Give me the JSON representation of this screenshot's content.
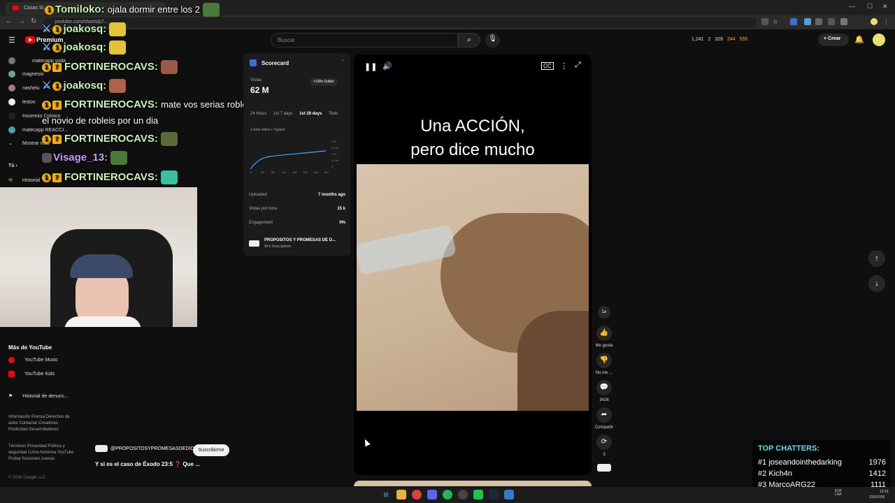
{
  "browser": {
    "tab_title": "Cosas Si...",
    "url": "youtube.com/shorts/p7...",
    "win_controls": [
      "—",
      "☐",
      "✕"
    ]
  },
  "header": {
    "brand": "Premium",
    "search_placeholder": "Buscar",
    "stats": [
      "1,241",
      "2",
      "328",
      "244",
      "555"
    ],
    "create_label": "+ Crear"
  },
  "sidebar": {
    "subscriptions": [
      {
        "label": "matecapp yoda"
      },
      {
        "label": "magnesio"
      },
      {
        "label": "nashelu"
      },
      {
        "label": "leston"
      },
      {
        "label": "Insomnio Crónico"
      },
      {
        "label": "matecapp REACCI..."
      }
    ],
    "show_more": "Mostrar más",
    "you": "Tú",
    "history": "Historial",
    "more_header": "Más de YouTube",
    "more_items": [
      {
        "label": "YouTube Music"
      },
      {
        "label": "YouTube Kids"
      }
    ],
    "report_history": "Historial de denunc...",
    "footer1": "Información  Prensa  Derechos de autor  Contactar  Creadores  Publicidad  Desarrolladores",
    "footer2": "Términos  Privacidad  Política y seguridad  Cómo funciona YouTube  Probar funciones nuevas",
    "copyright": "© 2026 Google LLC"
  },
  "chat": [
    {
      "user": "Tomiloko:",
      "msg": "ojala dormir entre los 2"
    },
    {
      "user": "joakosq:",
      "msg": ""
    },
    {
      "user": "joakosq:",
      "msg": ""
    },
    {
      "user": "FORTINEROCAVS:",
      "msg": ""
    },
    {
      "user": "joakosq:",
      "msg": ""
    },
    {
      "user": "FORTINEROCAVS:",
      "msg": "mate vos serias robleis o"
    },
    {
      "user": "",
      "msg": "el novio de robleis por un dia"
    },
    {
      "user": "FORTINEROCAVS:",
      "msg": ""
    },
    {
      "user": "Visage_13:",
      "msg": ""
    },
    {
      "user": "FORTINEROCAVS:",
      "msg": ""
    }
  ],
  "scorecard": {
    "title": "Scorecard",
    "views_label": "Vistas",
    "views_value": "62 M",
    "outlier": ">100x Outlier",
    "ranges": [
      "24 hours",
      "1st 7 days",
      "1st 28 days",
      "Todo"
    ],
    "active_range": "1st 28 days",
    "legend": [
      "Este video",
      "Typical"
    ],
    "y_ticks": [
      "6 M",
      "4.5 M",
      "3 M",
      "1.5 M",
      "0"
    ],
    "x_ticks": [
      "0",
      "40",
      "80",
      "120",
      "160",
      "200",
      "240",
      "280"
    ],
    "rows": [
      {
        "k": "Uploaded",
        "v": "7 months ago"
      },
      {
        "k": "Vistas por hora",
        "v": "15 k"
      },
      {
        "k": "Engagement",
        "v": "0%"
      }
    ],
    "channel_name": "PROPOSITOS Y PROMESAS DE D...",
    "channel_subs": "99 k Suscriptores"
  },
  "player": {
    "caption_line1": "Una ACCIÓN,",
    "caption_line2": "pero dice mucho"
  },
  "actions": {
    "speed": "1x",
    "like_label": "Me gusta",
    "dislike_label": "No me ...",
    "comments_count": "3426",
    "share_label": "Compartir",
    "remix_count": "3"
  },
  "channel": {
    "handle": "@PROPOSITOSYPROMESASDEDIOS",
    "subscribe_label": "Suscribirme",
    "video_title": "Y si es el caso de Éxodo 23:5 ❓ Que ..."
  },
  "top_chatters": {
    "title": "TOP CHATTERS:",
    "rows": [
      {
        "rank": "#1",
        "name": "joseandointhedarking",
        "count": "1976"
      },
      {
        "rank": "#2",
        "name": "Kich4n",
        "count": "1412"
      },
      {
        "rank": "#3",
        "name": "MarcoARG22",
        "count": "1111"
      }
    ]
  },
  "taskbar": {
    "lang": "ESP\nLAA",
    "time": "15:59",
    "date": "23/5/2026"
  },
  "colors": {
    "accent_red": "#ff0000",
    "chat_user": "#c8f4b4",
    "chatters_title": "#5ee0e8",
    "chart_line": "#3ea6ff"
  }
}
